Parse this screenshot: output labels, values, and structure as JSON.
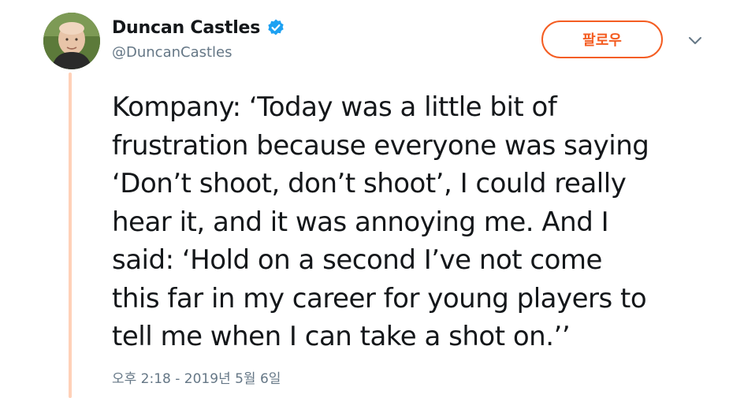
{
  "author": {
    "display_name": "Duncan Castles",
    "handle": "@DuncanCastles",
    "verified": true,
    "avatar_icon": "profile-photo"
  },
  "actions": {
    "follow_label": "팔로우",
    "caret_icon": "chevron-down-icon"
  },
  "tweet": {
    "text": "Kompany: ‘Today was a little bit of\nfrustration because everyone was saying\n‘Don’t shoot, don’t shoot’, I could really\nhear it, and it was annoying me. And I\nsaid: ‘Hold on a second I’ve not come\nthis far in my career for young players to\ntell me when I can take a shot on.’’",
    "timestamp": "오후 2:18 - 2019년 5월 6일"
  },
  "colors": {
    "accent": "#f45d22",
    "thread_line": "#ffd1b8",
    "verified": "#1da1f2",
    "secondary_text": "#657786",
    "primary_text": "#14171a"
  }
}
